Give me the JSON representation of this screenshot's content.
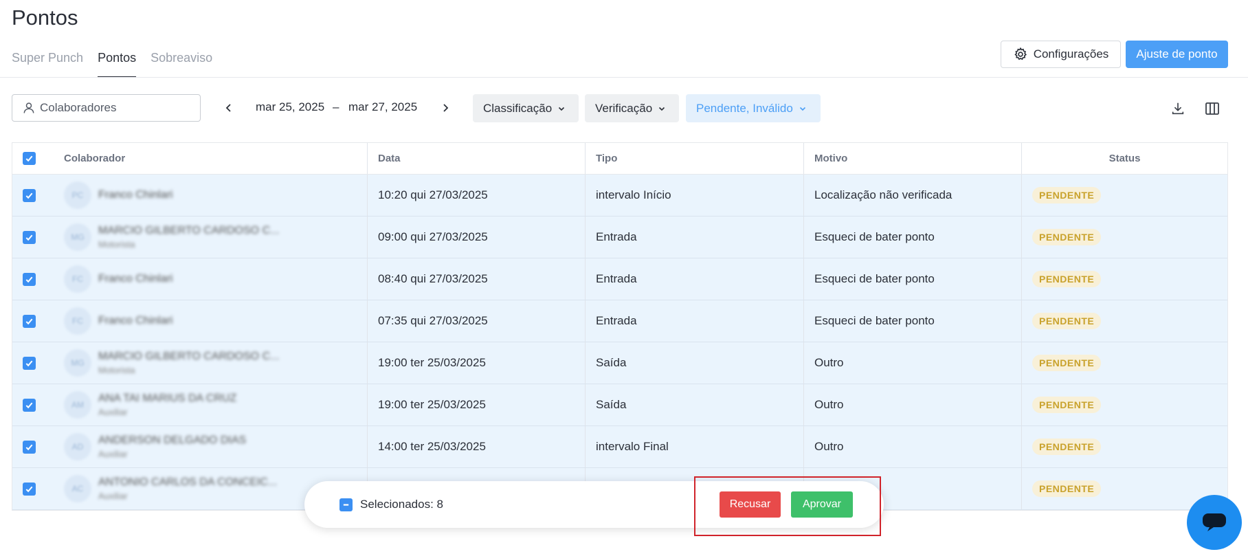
{
  "page": {
    "title": "Pontos"
  },
  "tabs": [
    {
      "label": "Super Punch",
      "active": false
    },
    {
      "label": "Pontos",
      "active": true
    },
    {
      "label": "Sobreaviso",
      "active": false
    }
  ],
  "header_actions": {
    "settings_label": "Configurações",
    "adjust_label": "Ajuste de ponto"
  },
  "filters": {
    "search_placeholder": "Colaboradores",
    "date_start": "mar 25, 2025",
    "date_separator": "–",
    "date_end": "mar 27, 2025",
    "classificacao": "Classificação",
    "verificacao": "Verificação",
    "status": "Pendente, Inválido"
  },
  "table": {
    "headers": {
      "colaborador": "Colaborador",
      "data": "Data",
      "tipo": "Tipo",
      "motivo": "Motivo",
      "status": "Status"
    },
    "rows": [
      {
        "avatar": "PC",
        "name": "Franco Chinlari",
        "role": "",
        "data": "10:20 qui 27/03/2025",
        "tipo": "intervalo Início",
        "motivo": "Localização não verificada",
        "status": "PENDENTE"
      },
      {
        "avatar": "MG",
        "name": "MARCIO GILBERTO CARDOSO C...",
        "role": "Motorista",
        "data": "09:00 qui 27/03/2025",
        "tipo": "Entrada",
        "motivo": "Esqueci de bater ponto",
        "status": "PENDENTE"
      },
      {
        "avatar": "FC",
        "name": "Franco Chinlari",
        "role": "",
        "data": "08:40 qui 27/03/2025",
        "tipo": "Entrada",
        "motivo": "Esqueci de bater ponto",
        "status": "PENDENTE"
      },
      {
        "avatar": "FC",
        "name": "Franco Chinlari",
        "role": "",
        "data": "07:35 qui 27/03/2025",
        "tipo": "Entrada",
        "motivo": "Esqueci de bater ponto",
        "status": "PENDENTE"
      },
      {
        "avatar": "MG",
        "name": "MARCIO GILBERTO CARDOSO C...",
        "role": "Motorista",
        "data": "19:00 ter 25/03/2025",
        "tipo": "Saída",
        "motivo": "Outro",
        "status": "PENDENTE"
      },
      {
        "avatar": "AM",
        "name": "ANA TAI MARIUS DA CRUZ",
        "role": "Auxiliar",
        "data": "19:00 ter 25/03/2025",
        "tipo": "Saída",
        "motivo": "Outro",
        "status": "PENDENTE"
      },
      {
        "avatar": "AD",
        "name": "ANDERSON DELGADO DIAS",
        "role": "Auxiliar",
        "data": "14:00 ter 25/03/2025",
        "tipo": "intervalo Final",
        "motivo": "Outro",
        "status": "PENDENTE"
      },
      {
        "avatar": "AC",
        "name": "ANTONIO CARLOS DA CONCEIC...",
        "role": "Auxiliar",
        "data": "",
        "tipo": "",
        "motivo": "",
        "status": "PENDENTE"
      }
    ]
  },
  "selection_bar": {
    "label": "Selecionados: 8",
    "reject_label": "Recusar",
    "approve_label": "Aprovar"
  },
  "colors": {
    "primary": "#4c9ff6",
    "reject": "#e84a4a",
    "approve": "#3ec06a",
    "pending_text": "#c9a22c",
    "pending_bg": "#f8f0d8",
    "row_selected_bg": "#eaf4fd"
  },
  "icons": {
    "settings": "gear-icon",
    "user": "user-icon",
    "download": "download-icon",
    "columns": "columns-icon",
    "chat": "chat-icon"
  }
}
